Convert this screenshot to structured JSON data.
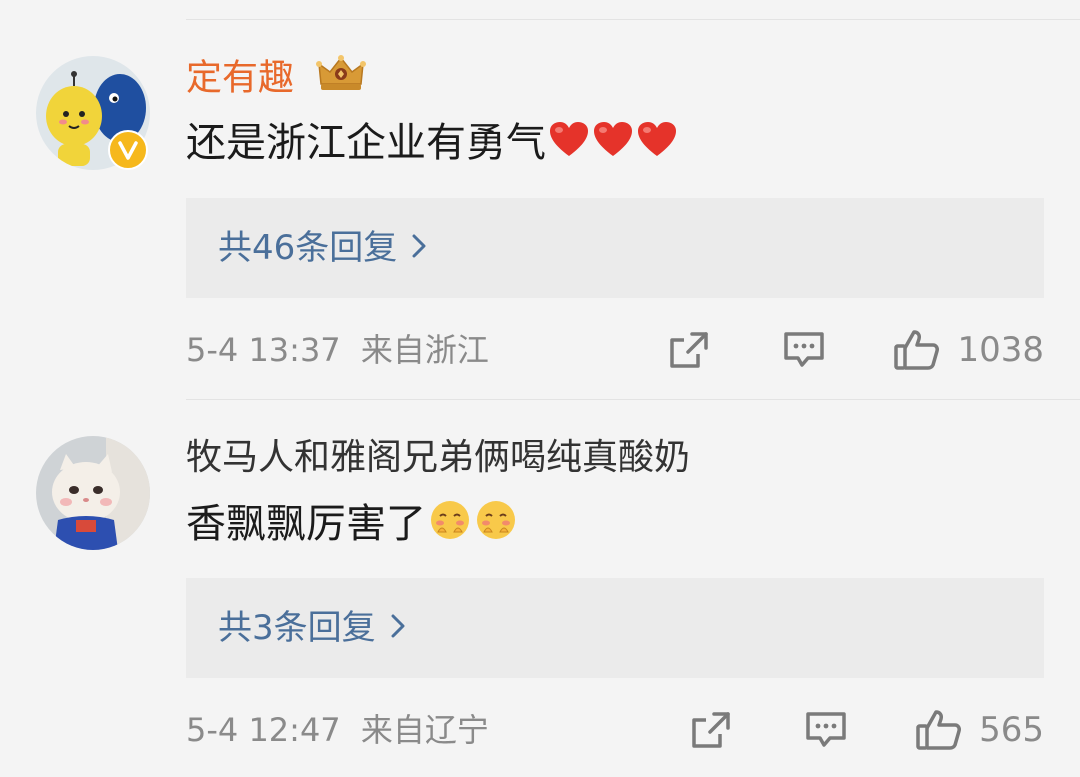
{
  "comments": [
    {
      "username": "定有趣",
      "username_color": "#e8692b",
      "badge_icon": "crown-badge-icon",
      "verified_icon": "verified-v-icon",
      "text": "还是浙江企业有勇气",
      "emojis": [
        "heart-emoji",
        "heart-emoji",
        "heart-emoji"
      ],
      "replies_label": "共46条回复",
      "time": "5-4 13:37",
      "location": "来自浙江",
      "likes": "1038"
    },
    {
      "username": "牧马人和雅阁兄弟俩喝纯真酸奶",
      "username_color": "#333333",
      "text": "香飘飘厉害了",
      "emojis": [
        "blush-emoji",
        "blush-emoji"
      ],
      "replies_label": "共3条回复",
      "time": "5-4 12:47",
      "location": "来自辽宁",
      "likes": "565"
    }
  ],
  "colors": {
    "link": "#4a6f9a",
    "meta": "#8a8a8a",
    "background": "#f4f4f4",
    "reply_box": "#ebebeb"
  }
}
